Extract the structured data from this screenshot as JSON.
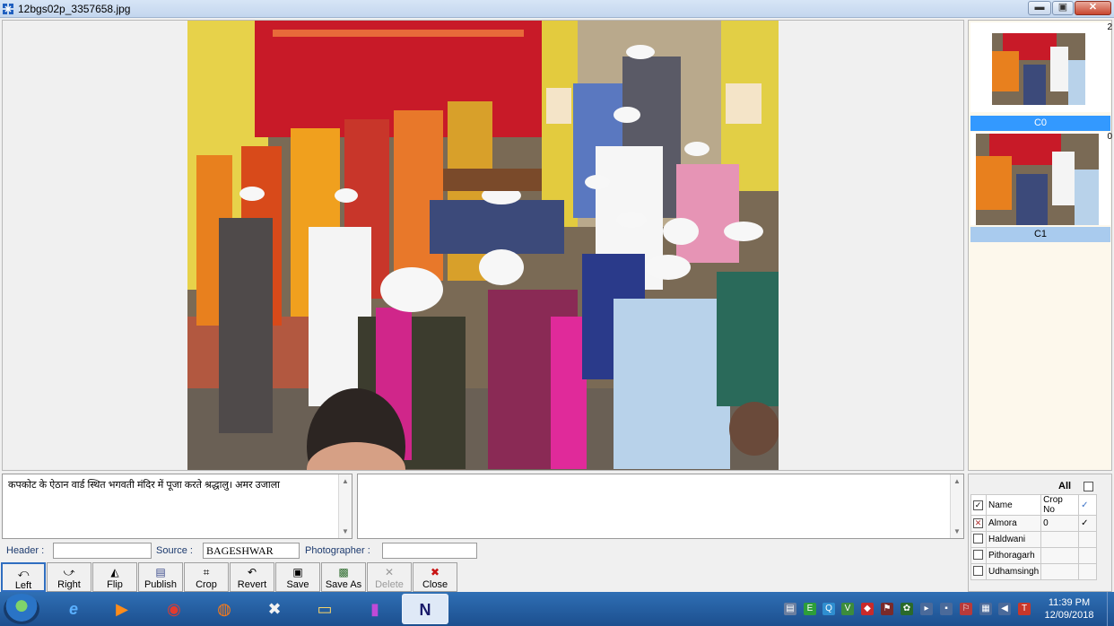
{
  "window": {
    "title": "12bgs02p_3357658.jpg",
    "minimize_glyph": "▬",
    "maximize_glyph": "▣",
    "close_glyph": "✕"
  },
  "thumbnails": [
    {
      "number": "2",
      "label": "C0",
      "active": true
    },
    {
      "number": "0",
      "label": "C1",
      "active": false
    }
  ],
  "caption": {
    "text": "कपकोट के ऐठान वार्ड स्थित भगवती मंदिर में पूजा करते श्रद्धालु। अमर उजाला"
  },
  "notes": {
    "text": ""
  },
  "fields": {
    "header_label": "Header :",
    "header_value": "",
    "source_label": "Source :",
    "source_value": "BAGESHWAR",
    "photographer_label": "Photographer :",
    "photographer_value": ""
  },
  "toolbar": [
    {
      "label": "Left",
      "icon": "rotate-left-icon",
      "glyph": "⤺",
      "color": "#333",
      "enabled": true
    },
    {
      "label": "Right",
      "icon": "rotate-right-icon",
      "glyph": "⤻",
      "color": "#333",
      "enabled": true
    },
    {
      "label": "Flip",
      "icon": "flip-icon",
      "glyph": "◭",
      "color": "#333",
      "enabled": true
    },
    {
      "label": "Publish",
      "icon": "publish-icon",
      "glyph": "▤",
      "color": "#3a4a8a",
      "enabled": true
    },
    {
      "label": "Crop",
      "icon": "crop-icon",
      "glyph": "⌗",
      "color": "#333",
      "enabled": true
    },
    {
      "label": "Revert",
      "icon": "revert-icon",
      "glyph": "↶",
      "color": "#333",
      "enabled": true
    },
    {
      "label": "Save",
      "icon": "save-icon",
      "glyph": "▣",
      "color": "#222",
      "enabled": true
    },
    {
      "label": "Save As",
      "icon": "save-as-icon",
      "glyph": "▩",
      "color": "#2d6b2d",
      "enabled": true
    },
    {
      "label": "Delete",
      "icon": "delete-icon",
      "glyph": "✕",
      "color": "#9a9a9a",
      "enabled": false
    },
    {
      "label": "Close",
      "icon": "close-icon",
      "glyph": "✖",
      "color": "#c81414",
      "enabled": true
    }
  ],
  "locations": {
    "all_label": "All",
    "columns": [
      "Name",
      "Crop No",
      "✓"
    ],
    "rows": [
      {
        "name": "Almora",
        "crop_no": "0",
        "mark": "✓",
        "checked": true
      },
      {
        "name": "Haldwani",
        "crop_no": "",
        "mark": "",
        "checked": false
      },
      {
        "name": "Pithoragarh",
        "crop_no": "",
        "mark": "",
        "checked": false
      },
      {
        "name": "Udhamsingh",
        "crop_no": "",
        "mark": "",
        "checked": false
      }
    ]
  },
  "taskbar": {
    "apps": [
      {
        "name": "internet-explorer-icon",
        "glyph": "e",
        "color": "#5ab0ff"
      },
      {
        "name": "media-player-icon",
        "glyph": "▶",
        "color": "#ff8c1a"
      },
      {
        "name": "chrome-icon",
        "glyph": "◉",
        "color": "#e33b2e"
      },
      {
        "name": "firefox-icon",
        "glyph": "◍",
        "color": "#ff7b14"
      },
      {
        "name": "crossover-app-icon",
        "glyph": "✖",
        "color": "#f2f2f2"
      },
      {
        "name": "file-explorer-icon",
        "glyph": "▭",
        "color": "#f5d36a"
      },
      {
        "name": "usb-app-icon",
        "glyph": "▮",
        "color": "#c04ad8"
      },
      {
        "name": "photo-app-icon",
        "glyph": "N",
        "color": "#1a1a6a"
      }
    ],
    "time": "11:39 PM",
    "date": "12/09/2018"
  },
  "colors": {
    "selected_thumb_label": "#3399ff",
    "thumb_label": "#a9cbee",
    "panel_bg": "#fdf8ec",
    "taskbar": "#2563a8"
  }
}
